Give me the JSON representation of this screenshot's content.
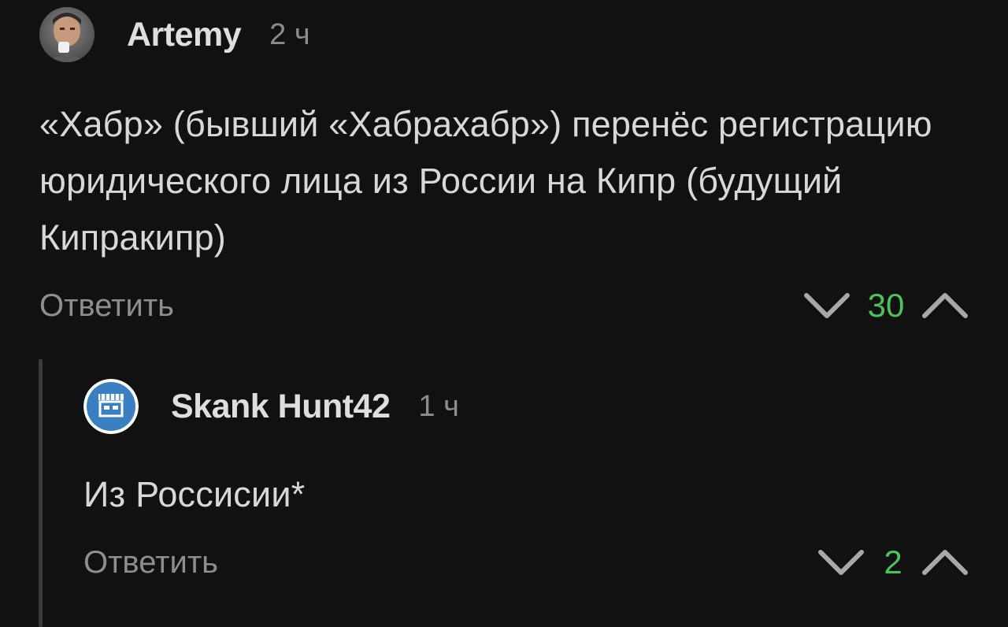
{
  "comments": [
    {
      "author": "Artemy",
      "time": "2 ч",
      "avatar_icon": "user-photo-avatar",
      "text": "«Хабр» (бывший «Хабрахабр») перенёс регистрацию юридического лица из России на Кипр (будущий Кипракипр)",
      "reply_label": "Ответить",
      "score": "30"
    },
    {
      "author": "Skank Hunt42",
      "time": "1 ч",
      "avatar_icon": "shop-icon",
      "text": "Из Россисии*",
      "reply_label": "Ответить",
      "score": "2"
    }
  ],
  "colors": {
    "background": "#111111",
    "score_positive": "#4fbf5f",
    "muted_text": "#8e8e8e",
    "avatar_blue": "#3a7fc0"
  }
}
